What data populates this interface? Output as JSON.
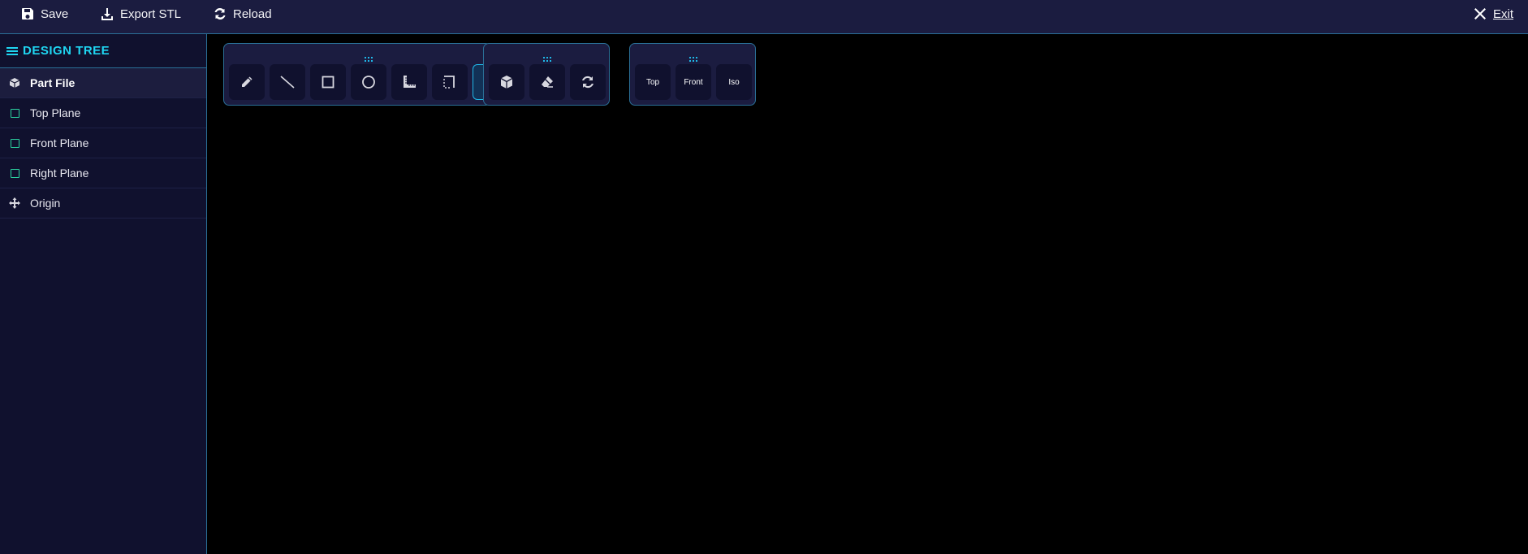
{
  "header": {
    "save_label": "Save",
    "export_label": "Export STL",
    "reload_label": "Reload",
    "exit_label": "Exit"
  },
  "sidebar": {
    "title": "DESIGN TREE",
    "items": [
      {
        "label": "Part File",
        "icon": "cube-icon"
      },
      {
        "label": "Top Plane",
        "icon": "plane-icon"
      },
      {
        "label": "Front Plane",
        "icon": "plane-icon"
      },
      {
        "label": "Right Plane",
        "icon": "plane-icon"
      },
      {
        "label": "Origin",
        "icon": "move-icon"
      }
    ]
  },
  "toolbars": {
    "sketch": [
      "pencil-icon",
      "line-icon",
      "rectangle-icon",
      "circle-icon",
      "ruler-icon",
      "offset-icon"
    ],
    "feature": [
      "cube-icon",
      "eraser-icon",
      "sync-icon"
    ],
    "views": [
      "Top",
      "Front",
      "Iso"
    ]
  },
  "colors": {
    "accent": "#1fd6f2",
    "border": "#2a6f96",
    "panel": "#1b1c40",
    "sidebar": "#10112e",
    "plane": "#2bd3a0"
  }
}
